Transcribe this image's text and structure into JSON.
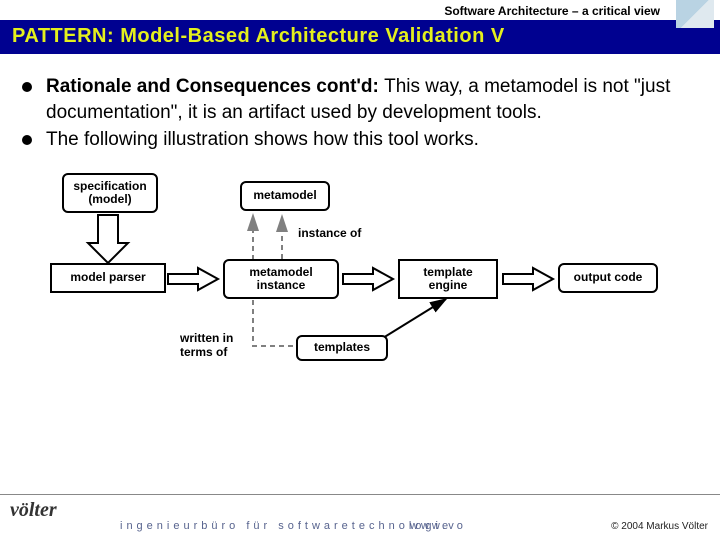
{
  "header": {
    "subtitle": "Software Architecture – a critical view"
  },
  "title": "PATTERN: Model-Based Architecture Validation V",
  "bullets": [
    {
      "bold": "Rationale and Consequences cont'd: ",
      "text": "This way, a metamodel is not \"just documentation\", it is an artifact used by development tools."
    },
    {
      "bold": "",
      "text": "The following illustration shows how this tool works."
    }
  ],
  "diagram": {
    "boxes": {
      "spec": "specification\n(model)",
      "meta": "metamodel",
      "parser": "model parser",
      "instance": "metamodel\ninstance",
      "engine": "template\nengine",
      "output": "output code",
      "templates": "templates"
    },
    "labels": {
      "instanceof": "instance of",
      "written": "written in\nterms of"
    }
  },
  "footer": {
    "brand": "völter",
    "tagline": "ingenieurbüro für softwaretechnologie",
    "url": "www.vo",
    "copyright": "© 2004  Markus Völter"
  }
}
